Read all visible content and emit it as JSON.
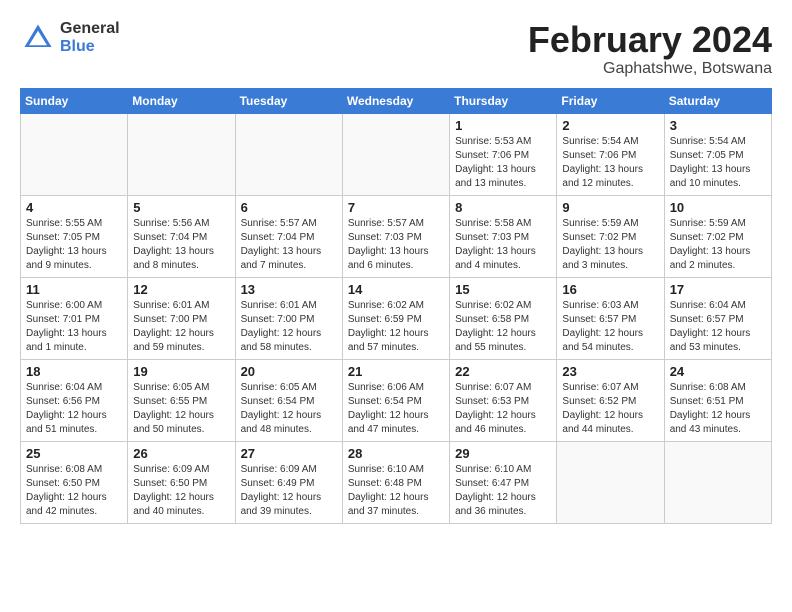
{
  "header": {
    "logo_general": "General",
    "logo_blue": "Blue",
    "title": "February 2024",
    "subtitle": "Gaphatshwe, Botswana"
  },
  "weekdays": [
    "Sunday",
    "Monday",
    "Tuesday",
    "Wednesday",
    "Thursday",
    "Friday",
    "Saturday"
  ],
  "weeks": [
    [
      {
        "day": "",
        "info": ""
      },
      {
        "day": "",
        "info": ""
      },
      {
        "day": "",
        "info": ""
      },
      {
        "day": "",
        "info": ""
      },
      {
        "day": "1",
        "info": "Sunrise: 5:53 AM\nSunset: 7:06 PM\nDaylight: 13 hours\nand 13 minutes."
      },
      {
        "day": "2",
        "info": "Sunrise: 5:54 AM\nSunset: 7:06 PM\nDaylight: 13 hours\nand 12 minutes."
      },
      {
        "day": "3",
        "info": "Sunrise: 5:54 AM\nSunset: 7:05 PM\nDaylight: 13 hours\nand 10 minutes."
      }
    ],
    [
      {
        "day": "4",
        "info": "Sunrise: 5:55 AM\nSunset: 7:05 PM\nDaylight: 13 hours\nand 9 minutes."
      },
      {
        "day": "5",
        "info": "Sunrise: 5:56 AM\nSunset: 7:04 PM\nDaylight: 13 hours\nand 8 minutes."
      },
      {
        "day": "6",
        "info": "Sunrise: 5:57 AM\nSunset: 7:04 PM\nDaylight: 13 hours\nand 7 minutes."
      },
      {
        "day": "7",
        "info": "Sunrise: 5:57 AM\nSunset: 7:03 PM\nDaylight: 13 hours\nand 6 minutes."
      },
      {
        "day": "8",
        "info": "Sunrise: 5:58 AM\nSunset: 7:03 PM\nDaylight: 13 hours\nand 4 minutes."
      },
      {
        "day": "9",
        "info": "Sunrise: 5:59 AM\nSunset: 7:02 PM\nDaylight: 13 hours\nand 3 minutes."
      },
      {
        "day": "10",
        "info": "Sunrise: 5:59 AM\nSunset: 7:02 PM\nDaylight: 13 hours\nand 2 minutes."
      }
    ],
    [
      {
        "day": "11",
        "info": "Sunrise: 6:00 AM\nSunset: 7:01 PM\nDaylight: 13 hours\nand 1 minute."
      },
      {
        "day": "12",
        "info": "Sunrise: 6:01 AM\nSunset: 7:00 PM\nDaylight: 12 hours\nand 59 minutes."
      },
      {
        "day": "13",
        "info": "Sunrise: 6:01 AM\nSunset: 7:00 PM\nDaylight: 12 hours\nand 58 minutes."
      },
      {
        "day": "14",
        "info": "Sunrise: 6:02 AM\nSunset: 6:59 PM\nDaylight: 12 hours\nand 57 minutes."
      },
      {
        "day": "15",
        "info": "Sunrise: 6:02 AM\nSunset: 6:58 PM\nDaylight: 12 hours\nand 55 minutes."
      },
      {
        "day": "16",
        "info": "Sunrise: 6:03 AM\nSunset: 6:57 PM\nDaylight: 12 hours\nand 54 minutes."
      },
      {
        "day": "17",
        "info": "Sunrise: 6:04 AM\nSunset: 6:57 PM\nDaylight: 12 hours\nand 53 minutes."
      }
    ],
    [
      {
        "day": "18",
        "info": "Sunrise: 6:04 AM\nSunset: 6:56 PM\nDaylight: 12 hours\nand 51 minutes."
      },
      {
        "day": "19",
        "info": "Sunrise: 6:05 AM\nSunset: 6:55 PM\nDaylight: 12 hours\nand 50 minutes."
      },
      {
        "day": "20",
        "info": "Sunrise: 6:05 AM\nSunset: 6:54 PM\nDaylight: 12 hours\nand 48 minutes."
      },
      {
        "day": "21",
        "info": "Sunrise: 6:06 AM\nSunset: 6:54 PM\nDaylight: 12 hours\nand 47 minutes."
      },
      {
        "day": "22",
        "info": "Sunrise: 6:07 AM\nSunset: 6:53 PM\nDaylight: 12 hours\nand 46 minutes."
      },
      {
        "day": "23",
        "info": "Sunrise: 6:07 AM\nSunset: 6:52 PM\nDaylight: 12 hours\nand 44 minutes."
      },
      {
        "day": "24",
        "info": "Sunrise: 6:08 AM\nSunset: 6:51 PM\nDaylight: 12 hours\nand 43 minutes."
      }
    ],
    [
      {
        "day": "25",
        "info": "Sunrise: 6:08 AM\nSunset: 6:50 PM\nDaylight: 12 hours\nand 42 minutes."
      },
      {
        "day": "26",
        "info": "Sunrise: 6:09 AM\nSunset: 6:50 PM\nDaylight: 12 hours\nand 40 minutes."
      },
      {
        "day": "27",
        "info": "Sunrise: 6:09 AM\nSunset: 6:49 PM\nDaylight: 12 hours\nand 39 minutes."
      },
      {
        "day": "28",
        "info": "Sunrise: 6:10 AM\nSunset: 6:48 PM\nDaylight: 12 hours\nand 37 minutes."
      },
      {
        "day": "29",
        "info": "Sunrise: 6:10 AM\nSunset: 6:47 PM\nDaylight: 12 hours\nand 36 minutes."
      },
      {
        "day": "",
        "info": ""
      },
      {
        "day": "",
        "info": ""
      }
    ]
  ]
}
